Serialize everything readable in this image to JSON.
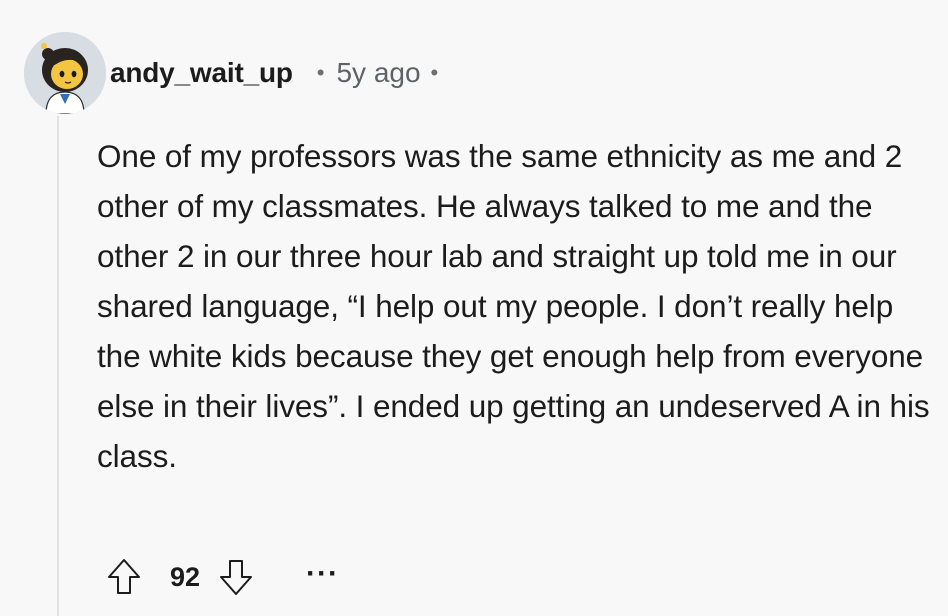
{
  "comment": {
    "author": "andy_wait_up",
    "separator": "•",
    "timestamp": "5y ago",
    "trailing_separator": "•",
    "body": "One of my professors was the same ethnicity as me and 2 other of my classmates. He always talked to me and the other 2 in our three hour lab and straight up told me in our shared language, “I help out my people. I don’t really help the white kids because they get enough help from everyone else in their lives”. I ended up getting an undeserved A in his class.",
    "score": "92",
    "more_label": "···"
  },
  "icons": {
    "avatar": "user-avatar",
    "upvote": "upvote-arrow-icon",
    "downvote": "downvote-arrow-icon",
    "more": "ellipsis-icon"
  },
  "colors": {
    "background": "#f8f8f8",
    "text": "#1c1c1c",
    "muted": "#5f6368",
    "thread_line": "#e2e2e2"
  }
}
